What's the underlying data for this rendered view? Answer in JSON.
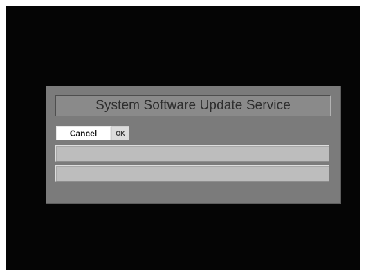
{
  "dialog": {
    "title": "System Software Update Service",
    "buttons": {
      "cancel_label": "Cancel",
      "ok_label": "OK"
    },
    "fields": [
      {
        "value": ""
      },
      {
        "value": ""
      }
    ]
  },
  "colors": {
    "screen_background": "#050505",
    "dialog_background": "#7b7b7b",
    "field_background": "#bdbdbd",
    "focused_button": "#ffffff"
  }
}
